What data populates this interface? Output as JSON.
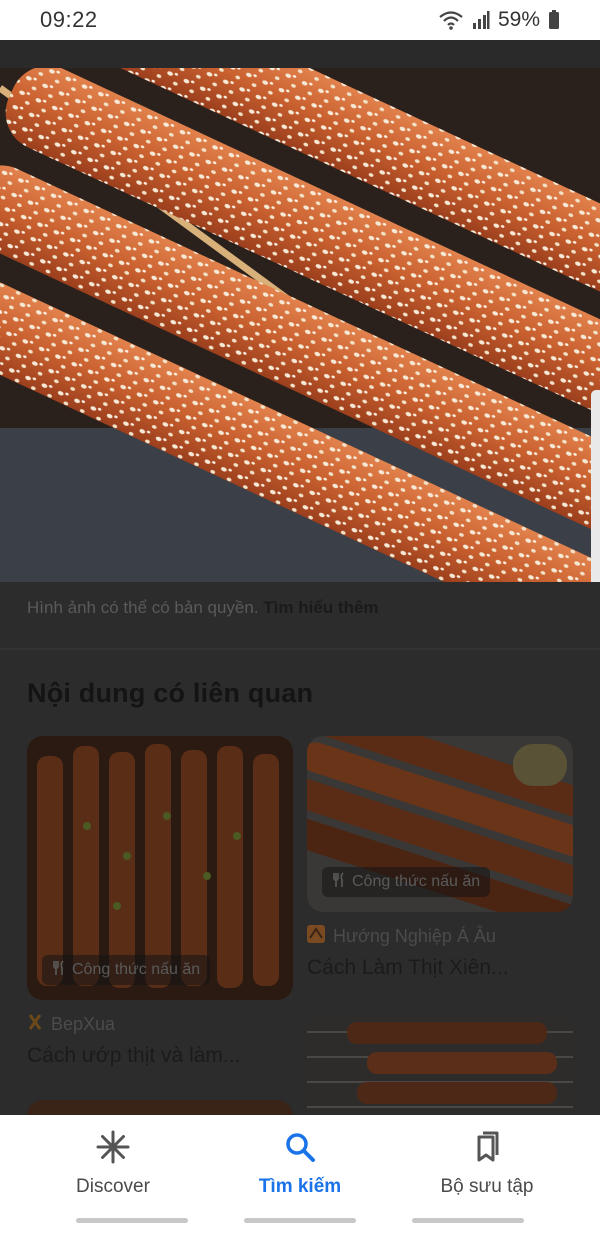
{
  "status_bar": {
    "time": "09:22",
    "battery": "59%"
  },
  "image_notice": {
    "text": "Hình ảnh có thể có bản quyền. ",
    "link": "Tìm hiểu thêm"
  },
  "related": {
    "title": "Nội dung có liên quan",
    "cards": [
      {
        "badge": "Công thức nấu ăn",
        "source": "BepXua",
        "title": "Cách ướp thịt và làm..."
      },
      {
        "badge": "Công thức nấu ăn",
        "source": "Hướng Nghiệp Á Âu",
        "title": "Cách Làm Thịt Xiên..."
      }
    ]
  },
  "bottom_nav": {
    "items": [
      {
        "label": "Discover",
        "icon": "asterisk-icon"
      },
      {
        "label": "Tìm kiếm",
        "icon": "search-icon"
      },
      {
        "label": "Bộ sưu tập",
        "icon": "collections-icon"
      }
    ],
    "active_index": 1,
    "active_color": "#1a73e8"
  }
}
